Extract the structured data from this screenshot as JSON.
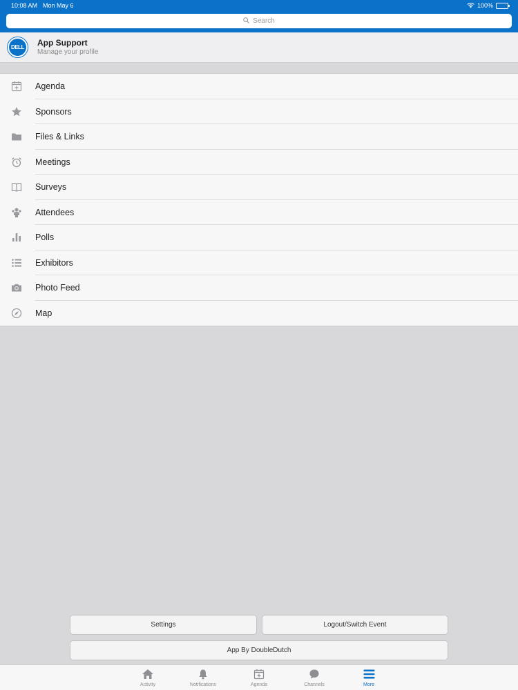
{
  "status_bar": {
    "time": "10:08 AM",
    "date": "Mon May 6",
    "battery": "100%"
  },
  "search": {
    "placeholder": "Search"
  },
  "profile": {
    "avatar_text": "DELL",
    "name": "App Support",
    "subtitle": "Manage your profile"
  },
  "menu": {
    "items": [
      {
        "label": "Agenda",
        "icon": "calendar-icon"
      },
      {
        "label": "Sponsors",
        "icon": "star-icon"
      },
      {
        "label": "Files & Links",
        "icon": "folder-icon"
      },
      {
        "label": "Meetings",
        "icon": "alarm-clock-icon"
      },
      {
        "label": "Surveys",
        "icon": "book-icon"
      },
      {
        "label": "Attendees",
        "icon": "people-icon"
      },
      {
        "label": "Polls",
        "icon": "bar-chart-icon"
      },
      {
        "label": "Exhibitors",
        "icon": "list-icon"
      },
      {
        "label": "Photo Feed",
        "icon": "camera-icon"
      },
      {
        "label": "Map",
        "icon": "compass-icon"
      }
    ]
  },
  "buttons": {
    "settings": "Settings",
    "logout": "Logout/Switch Event",
    "app_by": "App By DoubleDutch"
  },
  "tabs": [
    {
      "label": "Activity",
      "icon": "home-icon"
    },
    {
      "label": "Notifications",
      "icon": "bell-icon"
    },
    {
      "label": "Agenda",
      "icon": "calendar-icon"
    },
    {
      "label": "Channels",
      "icon": "chat-bubble-icon"
    },
    {
      "label": "More",
      "icon": "hamburger-icon",
      "active": true
    }
  ],
  "colors": {
    "brand_blue": "#0a72c9",
    "background": "#d8d8da",
    "icon_gray": "#9a9a9e"
  }
}
